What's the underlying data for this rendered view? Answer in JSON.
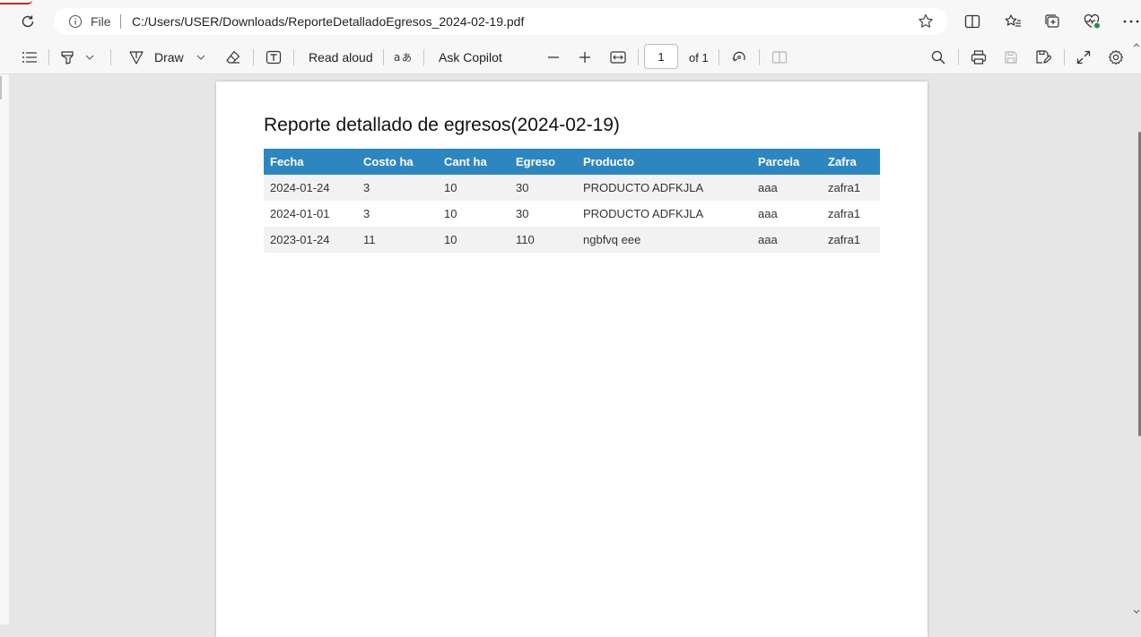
{
  "address_bar": {
    "file_label": "File",
    "url": "C:/Users/USER/Downloads/ReporteDetalladoEgresos_2024-02-19.pdf"
  },
  "toolbar": {
    "draw_label": "Draw",
    "read_aloud_label": "Read aloud",
    "ask_copilot_label": "Ask Copilot",
    "page_number": "1",
    "page_total": "of 1"
  },
  "report": {
    "title": "Reporte detallado de egresos(2024-02-19)",
    "columns": [
      "Fecha",
      "Costo ha",
      "Cant ha",
      "Egreso",
      "Producto",
      "Parcela",
      "Zafra"
    ],
    "rows": [
      [
        "2024-01-24",
        "3",
        "10",
        "30",
        "PRODUCTO ADFKJLA",
        "aaa",
        "zafra1"
      ],
      [
        "2024-01-01",
        "3",
        "10",
        "30",
        "PRODUCTO ADFKJLA",
        "aaa",
        "zafra1"
      ],
      [
        "2023-01-24",
        "11",
        "10",
        "110",
        "ngbfvq eee",
        "aaa",
        "zafra1"
      ]
    ]
  },
  "colors": {
    "table_header_bg": "#2e86c1",
    "row_odd_bg": "#f2f2f2",
    "row_even_bg": "#ffffff",
    "viewer_bg": "#e6e6e6"
  }
}
